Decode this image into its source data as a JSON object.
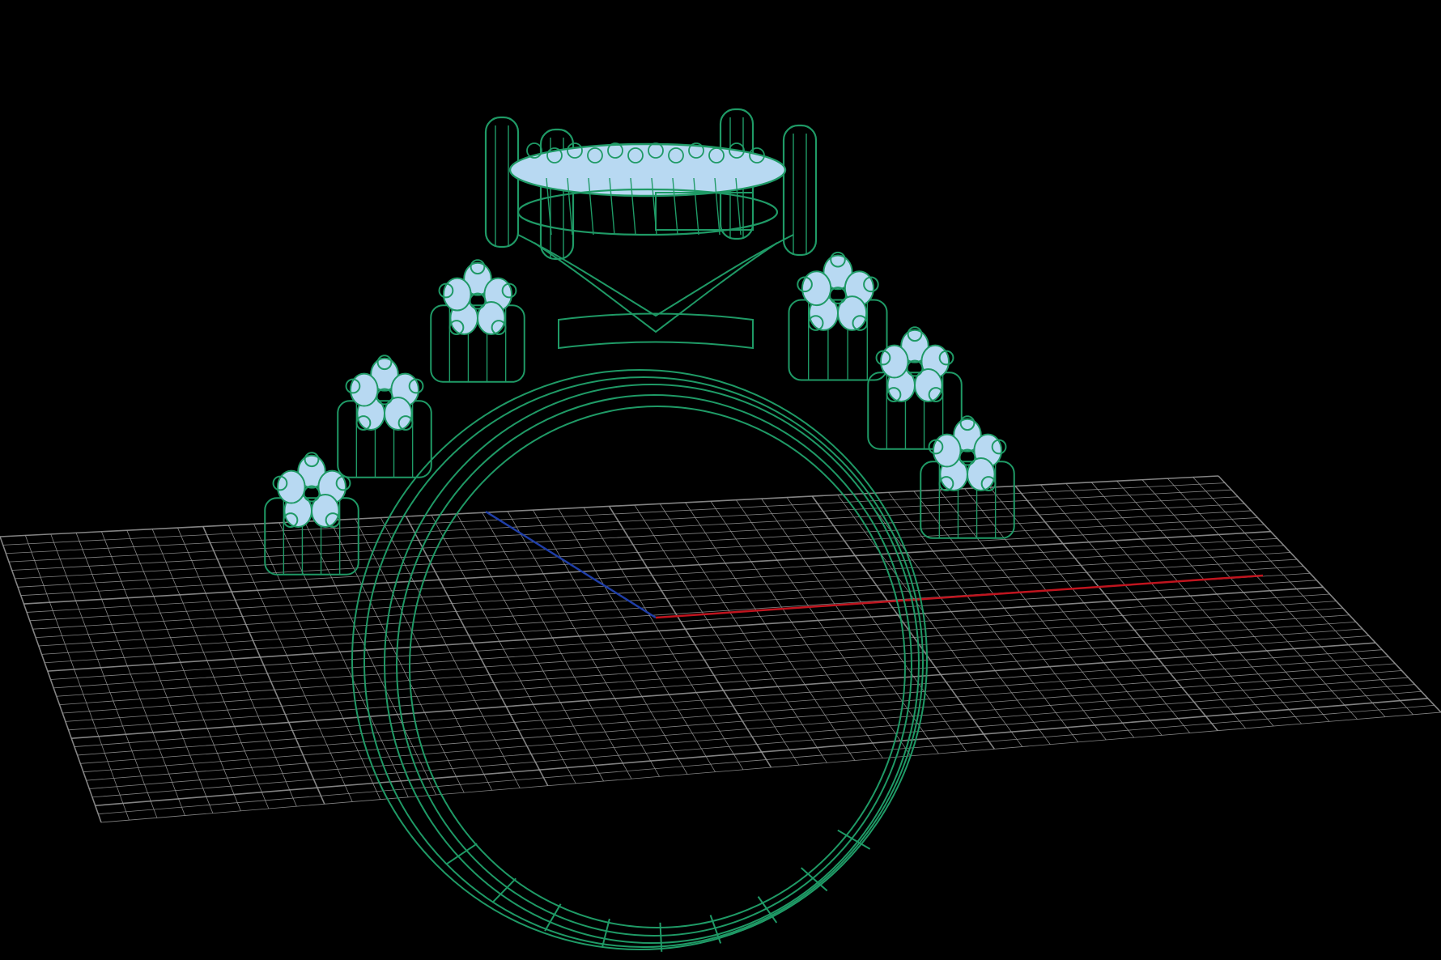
{
  "viewport": {
    "background": "#000000",
    "grid_color": "#9a9a9a",
    "axis_x_color": "#c0141e",
    "axis_y_color": "#1f3ea8",
    "wire_color": "#1f9a66",
    "stone_fill": "#b8d9f2",
    "model": "ring-wireframe",
    "grid": true
  }
}
